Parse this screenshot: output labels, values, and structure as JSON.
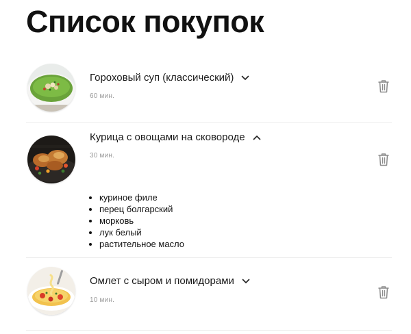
{
  "page": {
    "title": "Список покупок"
  },
  "recipes": [
    {
      "name": "Гороховый суп (классический)",
      "time": "60 мин.",
      "expanded": false,
      "image": "pea-soup"
    },
    {
      "name": "Курица с овощами на сковороде",
      "time": "30 мин.",
      "expanded": true,
      "image": "roast-chicken",
      "ingredients": [
        "куриное филе",
        "перец болгарский",
        "морковь",
        "лук белый",
        "растительное масло"
      ]
    },
    {
      "name": "Омлет с сыром и помидорами",
      "time": "10 мин.",
      "expanded": false,
      "image": "omelette"
    }
  ],
  "icons": {
    "expand": "chevron-down-icon",
    "collapse": "chevron-up-icon",
    "delete": "trash-icon"
  },
  "colors": {
    "text": "#111111",
    "muted": "#9a9a9a",
    "divider": "#ececec",
    "icon": "#8a8a8a"
  }
}
